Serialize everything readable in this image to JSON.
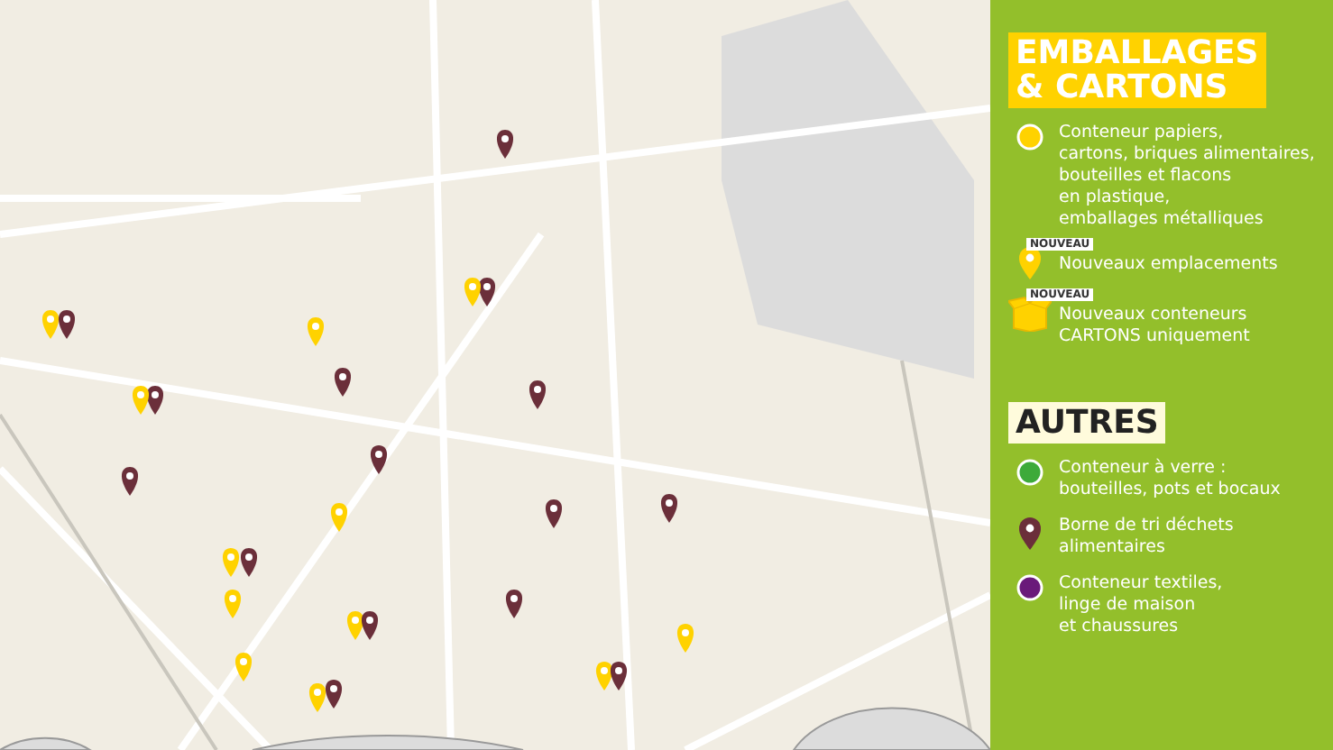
{
  "legend": {
    "sections": [
      {
        "title_lines": [
          "EMBALLAGES",
          "& CARTONS"
        ],
        "items": [
          {
            "kind": "dot",
            "color": "#ffd200",
            "lines": [
              "Conteneur papiers,",
              "cartons, briques alimentaires,",
              "bouteilles et flacons",
              "en plastique,",
              "emballages métalliques"
            ]
          },
          {
            "kind": "pin",
            "color": "#ffd200",
            "badge": "NOUVEAU",
            "lines": [
              "Nouveaux emplacements"
            ]
          },
          {
            "kind": "box",
            "color": "#ffd200",
            "badge": "NOUVEAU",
            "lines": [
              "Nouveaux conteneurs",
              "CARTONS uniquement"
            ]
          }
        ]
      },
      {
        "title_lines": [
          "AUTRES"
        ],
        "items": [
          {
            "kind": "dot",
            "color": "#3daa3a",
            "lines": [
              "Conteneur à verre :",
              "bouteilles, pots et bocaux"
            ]
          },
          {
            "kind": "pin",
            "color": "#6b2f3a",
            "lines": [
              "Borne de tri déchets",
              "alimentaires"
            ]
          },
          {
            "kind": "dot",
            "color": "#6a1a7a",
            "lines": [
              "Conteneur textiles,",
              "linge de maison",
              "et chaussures"
            ]
          }
        ]
      }
    ]
  }
}
